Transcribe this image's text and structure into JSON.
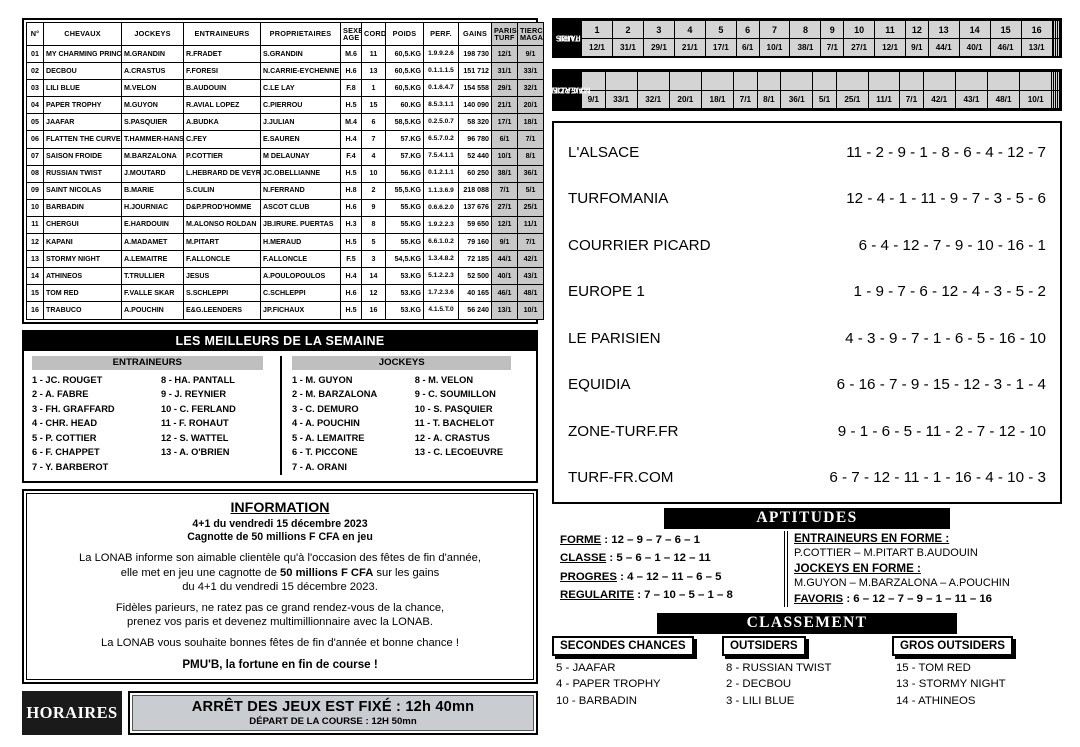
{
  "runners_table": {
    "headers": [
      "N°",
      "CHEVAUX",
      "JOCKEYS",
      "ENTRAINEURS",
      "PROPRIETAIRES",
      "SEXE AGE",
      "CORDE",
      "POIDS",
      "PERF.",
      "GAINS",
      "PARIS TURF",
      "TIERCE MAGAZINE"
    ],
    "header_sexe_l1": "SEXE",
    "header_sexe_l2": "AGE",
    "header_pt_l1": "PARIS",
    "header_pt_l2": "TURF",
    "header_tm_l1": "TIERCE",
    "header_tm_l2": "MAGAZINE",
    "rows": [
      {
        "num": "01",
        "cheval": "MY CHARMING PRINCE",
        "jockey": "M.GRANDIN",
        "entraineur": "R.FRADET",
        "proprietaire": "S.GRANDIN",
        "sexe": "M.6",
        "corde": "11",
        "poids": "60,5.KG",
        "perf": "1.9.9.2.6",
        "gains": "198 730",
        "pt": "12/1",
        "tm": "9/1"
      },
      {
        "num": "02",
        "cheval": "DECBOU",
        "jockey": "A.CRASTUS",
        "entraineur": "F.FORESI",
        "proprietaire": "N.CARRIE-EYCHENNE",
        "sexe": "H.6",
        "corde": "13",
        "poids": "60,5.KG",
        "perf": "0.1.1.1.5",
        "gains": "151 712",
        "pt": "31/1",
        "tm": "33/1"
      },
      {
        "num": "03",
        "cheval": "LILI BLUE",
        "jockey": "M.VELON",
        "entraineur": "B.AUDOUIN",
        "proprietaire": "C.LE LAY",
        "sexe": "F.8",
        "corde": "1",
        "poids": "60,5.KG",
        "perf": "0.1.6.4.7",
        "gains": "154 558",
        "pt": "29/1",
        "tm": "32/1"
      },
      {
        "num": "04",
        "cheval": "PAPER TROPHY",
        "jockey": "M.GUYON",
        "entraineur": "R.AVIAL LOPEZ",
        "proprietaire": "C.PIERROU",
        "sexe": "H.5",
        "corde": "15",
        "poids": "60.KG",
        "perf": "8.5.3.1.1",
        "gains": "140 090",
        "pt": "21/1",
        "tm": "20/1"
      },
      {
        "num": "05",
        "cheval": "JAAFAR",
        "jockey": "S.PASQUIER",
        "entraineur": "A.BUDKA",
        "proprietaire": "J.JULIAN",
        "sexe": "M.4",
        "corde": "6",
        "poids": "58,5.KG",
        "perf": "0.2.5.0.7",
        "gains": "58 320",
        "pt": "17/1",
        "tm": "18/1"
      },
      {
        "num": "06",
        "cheval": "FLATTEN THE CURVE",
        "jockey": "T.HAMMER-HANSEN",
        "entraineur": "C.FEY",
        "proprietaire": "E.SAUREN",
        "sexe": "H.4",
        "corde": "7",
        "poids": "57.KG",
        "perf": "6.5.7.0.2",
        "gains": "96 780",
        "pt": "6/1",
        "tm": "7/1"
      },
      {
        "num": "07",
        "cheval": "SAISON FROIDE",
        "jockey": "M.BARZALONA",
        "entraineur": "P.COTTIER",
        "proprietaire": "M DELAUNAY",
        "sexe": "F.4",
        "corde": "4",
        "poids": "57.KG",
        "perf": "7.5.4.1.1",
        "gains": "52 440",
        "pt": "10/1",
        "tm": "8/1"
      },
      {
        "num": "08",
        "cheval": "RUSSIAN TWIST",
        "jockey": "J.MOUTARD",
        "entraineur": "L.HEBRARD DE VEYRINAS",
        "proprietaire": "JC.OBELLIANNE",
        "sexe": "H.5",
        "corde": "10",
        "poids": "56.KG",
        "perf": "0.1.2.1.1",
        "gains": "60 250",
        "pt": "38/1",
        "tm": "36/1"
      },
      {
        "num": "09",
        "cheval": "SAINT NICOLAS",
        "jockey": "B.MARIE",
        "entraineur": "S.CULIN",
        "proprietaire": "N.FERRAND",
        "sexe": "H.8",
        "corde": "2",
        "poids": "55,5.KG",
        "perf": "1.1.3.6.9",
        "gains": "218 088",
        "pt": "7/1",
        "tm": "5/1"
      },
      {
        "num": "10",
        "cheval": "BARBADIN",
        "jockey": "H.JOURNIAC",
        "entraineur": "D&P.PROD'HOMME",
        "proprietaire": "ASCOT CLUB",
        "sexe": "H.6",
        "corde": "9",
        "poids": "55.KG",
        "perf": "0.6.6.2.0",
        "gains": "137 676",
        "pt": "27/1",
        "tm": "25/1"
      },
      {
        "num": "11",
        "cheval": "CHERGUI",
        "jockey": "E.HARDOUIN",
        "entraineur": "M.ALONSO ROLDAN",
        "proprietaire": "JB.IRURE. PUERTAS",
        "sexe": "H.3",
        "corde": "8",
        "poids": "55.KG",
        "perf": "1.9.2.2.3",
        "gains": "59 650",
        "pt": "12/1",
        "tm": "11/1"
      },
      {
        "num": "12",
        "cheval": "KAPANI",
        "jockey": "A.MADAMET",
        "entraineur": "M.PITART",
        "proprietaire": "H.MERAUD",
        "sexe": "H.5",
        "corde": "5",
        "poids": "55.KG",
        "perf": "6.6.1.0.2",
        "gains": "79 160",
        "pt": "9/1",
        "tm": "7/1"
      },
      {
        "num": "13",
        "cheval": "STORMY NIGHT",
        "jockey": "A.LEMAITRE",
        "entraineur": "F.ALLONCLE",
        "proprietaire": "F.ALLONCLE",
        "sexe": "F.5",
        "corde": "3",
        "poids": "54,5.KG",
        "perf": "1.3.4.8.2",
        "gains": "72 185",
        "pt": "44/1",
        "tm": "42/1"
      },
      {
        "num": "14",
        "cheval": "ATHINEOS",
        "jockey": "T.TRULLIER",
        "entraineur": "JESUS",
        "proprietaire": "A.POULOPOULOS",
        "sexe": "H.4",
        "corde": "14",
        "poids": "53.KG",
        "perf": "5.1.2.2.3",
        "gains": "52 500",
        "pt": "40/1",
        "tm": "43/1"
      },
      {
        "num": "15",
        "cheval": "TOM RED",
        "jockey": "F.VALLE SKAR",
        "entraineur": "S.SCHLEPPI",
        "proprietaire": "C.SCHLEPPI",
        "sexe": "H.6",
        "corde": "12",
        "poids": "53.KG",
        "perf": "1.7.2.3.6",
        "gains": "40 165",
        "pt": "46/1",
        "tm": "48/1"
      },
      {
        "num": "16",
        "cheval": "TRABUCO",
        "jockey": "A.POUCHIN",
        "entraineur": "E&G.LEENDERS",
        "proprietaire": "JP.FICHAUX",
        "sexe": "H.5",
        "corde": "16",
        "poids": "53.KG",
        "perf": "4.1.5.T.0",
        "gains": "56 240",
        "pt": "13/1",
        "tm": "10/1"
      }
    ]
  },
  "best_of_week": {
    "title": "LES MEILLEURS DE LA SEMAINE",
    "trainers_title": "ENTRAINEURS",
    "jockeys_title": "JOCKEYS",
    "trainers_col1": [
      "1 - JC. ROUGET",
      "2 - A. FABRE",
      "3 - FH. GRAFFARD",
      "4 - CHR. HEAD",
      "5 - P. COTTIER",
      "6 - F. CHAPPET",
      "7 - Y. BARBEROT"
    ],
    "trainers_col2": [
      "8 - HA. PANTALL",
      "9 - J. REYNIER",
      "10 - C. FERLAND",
      "11 - F. ROHAUT",
      "12 - S. WATTEL",
      "13 - A. O'BRIEN"
    ],
    "jockeys_col1": [
      "1 - M. GUYON",
      "2 - M. BARZALONA",
      "3 - C. DEMURO",
      "4 - A. POUCHIN",
      "5 - A. LEMAITRE",
      "6 - T. PICCONE",
      "7 - A. ORANI"
    ],
    "jockeys_col2": [
      "8 - M. VELON",
      "9 - C. SOUMILLON",
      "10 - S. PASQUIER",
      "11 - T. BACHELOT",
      "12 - A. CRASTUS",
      "13 - C. LECOEUVRE"
    ]
  },
  "information": {
    "title": "INFORMATION",
    "sub1": "4+1 du vendredi 15 décembre 2023",
    "sub2": "Cagnotte de 50 millions F CFA en jeu",
    "para1_a": "La LONAB informe son aimable clientèle qu'à l'occasion des fêtes de fin d'année,",
    "para1_b": "elle met en jeu une cagnotte de ",
    "para1_bold": "50 millions F CFA",
    "para1_c": " sur les gains",
    "para1_d": "du 4+1 du vendredi 15 décembre 2023.",
    "para2_a": "Fidèles parieurs, ne ratez pas ce grand rendez-vous de la chance,",
    "para2_b": "prenez vos paris et devenez multimillionnaire avec la LONAB.",
    "para3": "La LONAB vous souhaite bonnes fêtes de fin d'année et bonne chance !",
    "slogan": "PMU'B, la fortune en fin de course !"
  },
  "horaires": {
    "label": "HORAIRES",
    "line1": "ARRÊT DES JEUX EST FIXÉ : 12h 40mn",
    "line2": "DÉPART DE LA COURSE : 12H 50mn"
  },
  "paris_turf_grid": {
    "label_l1": "PARIS",
    "label_l2": "TURF",
    "numbers": [
      "1",
      "2",
      "3",
      "4",
      "5",
      "6",
      "7",
      "8",
      "9",
      "10",
      "11",
      "12",
      "13",
      "14",
      "15",
      "16",
      "",
      "",
      "",
      ""
    ],
    "odds": [
      "12/1",
      "31/1",
      "29/1",
      "21/1",
      "17/1",
      "6/1",
      "10/1",
      "38/1",
      "7/1",
      "27/1",
      "12/1",
      "9/1",
      "44/1",
      "40/1",
      "46/1",
      "13/1",
      "",
      "",
      "",
      ""
    ]
  },
  "tierce_magazine_grid": {
    "label_l1": "TIERCE",
    "label_l2": "MAGAZINE",
    "top": [
      "",
      "",
      "",
      "",
      "",
      "",
      "",
      "",
      "",
      "",
      "",
      "",
      "",
      "",
      "",
      "",
      "",
      "",
      "",
      ""
    ],
    "odds": [
      "9/1",
      "33/1",
      "32/1",
      "20/1",
      "18/1",
      "7/1",
      "8/1",
      "36/1",
      "5/1",
      "25/1",
      "11/1",
      "7/1",
      "42/1",
      "43/1",
      "48/1",
      "10/1",
      "",
      "",
      "",
      ""
    ]
  },
  "pronostics": [
    {
      "source": "L'ALSACE",
      "picks": "11 - 2 - 9 - 1 - 8 - 6 - 4 - 12 - 7"
    },
    {
      "source": "TURFOMANIA",
      "picks": "12 - 4 - 1 - 11 - 9 - 7 - 3 - 5 - 6"
    },
    {
      "source": "COURRIER PICARD",
      "picks": "6 - 4 - 12 - 7 - 9 - 10 - 16 - 1"
    },
    {
      "source": "EUROPE 1",
      "picks": "1 - 9 - 7 - 6 - 12 - 4 - 3 - 5 - 2"
    },
    {
      "source": "LE PARISIEN",
      "picks": "4 - 3 - 9 - 7 - 1 - 6 - 5 - 16 - 10"
    },
    {
      "source": "EQUIDIA",
      "picks": "6 - 16 - 7 - 9 - 15 - 12 - 3 - 1 - 4"
    },
    {
      "source": "ZONE-TURF.FR",
      "picks": "9 - 1 - 6 - 5 - 11 - 2 - 7 - 12 - 10"
    },
    {
      "source": "TURF-FR.COM",
      "picks": "6 - 7 - 12 - 11 - 1 - 16 - 4 - 10 - 3"
    }
  ],
  "aptitudes": {
    "title": "APTITUDES",
    "forme_label": "FORME",
    "forme_value": " : 12 – 9 – 7 – 6 – 1",
    "classe_label": "CLASSE",
    "classe_value": " : 5 – 6 – 1 – 12 – 11",
    "progres_label": "PROGRES",
    "progres_value": " : 4 – 12 – 11 – 6 – 5",
    "regularite_label": "REGULARITE",
    "regularite_value": " : 7 – 10 – 5 – 1 – 8",
    "entraineurs_heading": "ENTRAINEURS EN FORME :",
    "entraineurs_value": "P.COTTIER – M.PITART B.AUDOUIN",
    "jockeys_heading": "JOCKEYS EN FORME :",
    "jockeys_value": "M.GUYON – M.BARZALONA – A.POUCHIN",
    "favoris_label": "FAVORIS",
    "favoris_value": " : 6 – 12 – 7 – 9 – 1 – 11 – 16"
  },
  "classement": {
    "title": "CLASSEMENT",
    "columns": [
      {
        "heading": "SECONDES CHANCES",
        "items": [
          "5 - JAAFAR",
          "4 - PAPER TROPHY",
          "10 - BARBADIN"
        ]
      },
      {
        "heading": "OUTSIDERS",
        "items": [
          "8 - RUSSIAN TWIST",
          "2 - DECBOU",
          "3 - LILI BLUE"
        ]
      },
      {
        "heading": "GROS OUTSIDERS",
        "items": [
          "15 - TOM RED",
          "13 - STORMY NIGHT",
          "14 - ATHINEOS"
        ]
      }
    ]
  }
}
